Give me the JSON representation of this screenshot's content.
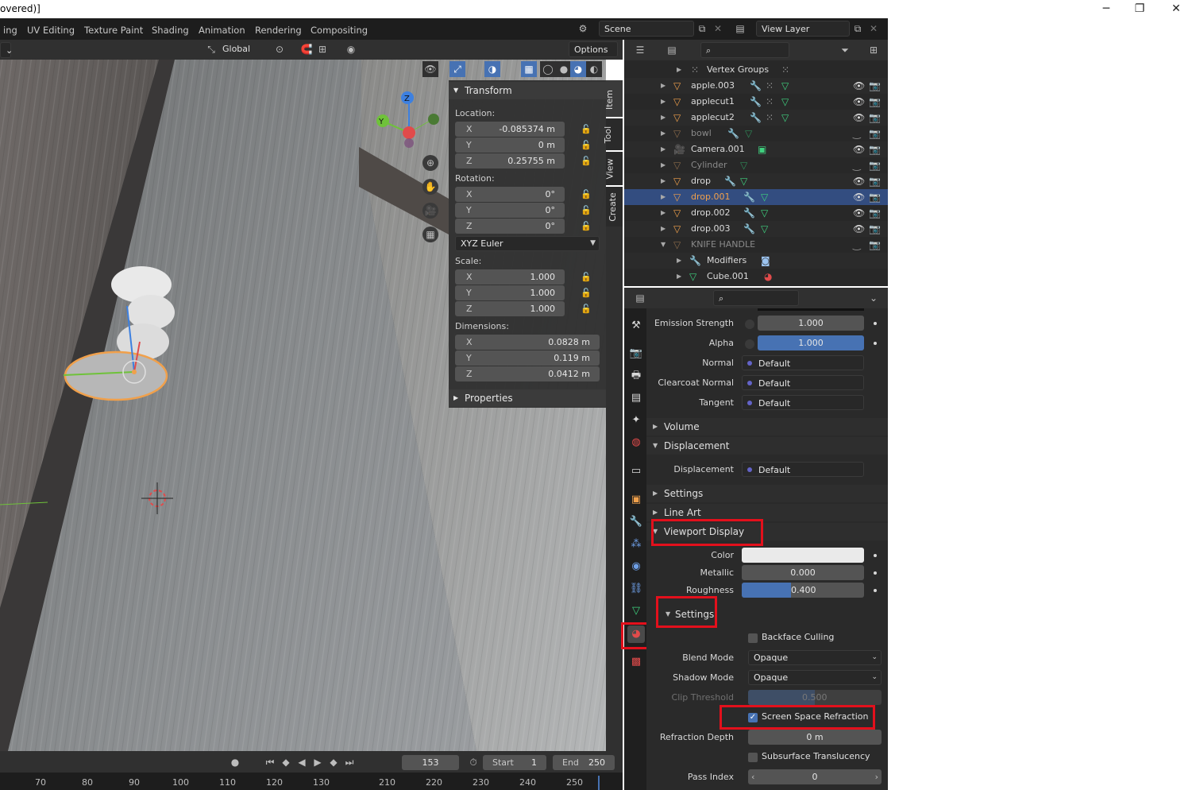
{
  "titlebar": {
    "title": "overed)]",
    "min": "─",
    "max": "❐",
    "close": "✕"
  },
  "workspaces": [
    "ing",
    "UV Editing",
    "Texture Paint",
    "Shading",
    "Animation",
    "Rendering",
    "Compositing"
  ],
  "scene": {
    "name": "Scene",
    "view_layer": "View Layer"
  },
  "viewport_header": {
    "orientation": "Global",
    "options": "Options"
  },
  "npanel": {
    "title": "Transform",
    "location_label": "Location:",
    "location": [
      [
        "X",
        "-0.085374 m"
      ],
      [
        "Y",
        "0 m"
      ],
      [
        "Z",
        "0.25755 m"
      ]
    ],
    "rotation_label": "Rotation:",
    "rotation": [
      [
        "X",
        "0°"
      ],
      [
        "Y",
        "0°"
      ],
      [
        "Z",
        "0°"
      ]
    ],
    "rotation_mode": "XYZ Euler",
    "scale_label": "Scale:",
    "scale": [
      [
        "X",
        "1.000"
      ],
      [
        "Y",
        "1.000"
      ],
      [
        "Z",
        "1.000"
      ]
    ],
    "dimensions_label": "Dimensions:",
    "dimensions": [
      [
        "X",
        "0.0828 m"
      ],
      [
        "Y",
        "0.119 m"
      ],
      [
        "Z",
        "0.0412 m"
      ]
    ],
    "properties": "Properties",
    "tabs": [
      "Item",
      "Tool",
      "View",
      "Create"
    ]
  },
  "outliner": {
    "rows": [
      {
        "name": "Vertex Groups"
      },
      {
        "name": "apple.003"
      },
      {
        "name": "applecut1"
      },
      {
        "name": "applecut2"
      },
      {
        "name": "bowl"
      },
      {
        "name": "Camera.001"
      },
      {
        "name": "Cylinder"
      },
      {
        "name": "drop"
      },
      {
        "name": "drop.001"
      },
      {
        "name": "drop.002"
      },
      {
        "name": "drop.003"
      },
      {
        "name": "KNIFE HANDLE"
      },
      {
        "name": "Modifiers"
      },
      {
        "name": "Cube.001"
      }
    ]
  },
  "properties": {
    "emission_strength_label": "Emission Strength",
    "emission_strength": "1.000",
    "alpha_label": "Alpha",
    "alpha": "1.000",
    "normal_label": "Normal",
    "normal": "Default",
    "clearcoat_normal_label": "Clearcoat Normal",
    "clearcoat_normal": "Default",
    "tangent_label": "Tangent",
    "tangent": "Default",
    "volume": "Volume",
    "displacement_section": "Displacement",
    "displacement_label": "Displacement",
    "displacement": "Default",
    "settings_section": "Settings",
    "line_art": "Line Art",
    "viewport_display": "Viewport Display",
    "color_label": "Color",
    "metallic_label": "Metallic",
    "metallic": "0.000",
    "roughness_label": "Roughness",
    "roughness": "0.400",
    "roughness_fraction": 0.4,
    "settings_sub": "Settings",
    "backface_culling": "Backface Culling",
    "blend_mode_label": "Blend Mode",
    "blend_mode": "Opaque",
    "shadow_mode_label": "Shadow Mode",
    "shadow_mode": "Opaque",
    "clip_threshold_label": "Clip Threshold",
    "clip_threshold": "0.500",
    "screen_space_refraction": "Screen Space Refraction",
    "refraction_depth_label": "Refraction Depth",
    "refraction_depth": "0 m",
    "subsurface_translucency": "Subsurface Translucency",
    "pass_index_label": "Pass Index",
    "pass_index": "0"
  },
  "timeline": {
    "current_frame": "153",
    "start_label": "Start",
    "start": "1",
    "end_label": "End",
    "end": "250"
  },
  "ruler_ticks": [
    "70",
    "80",
    "90",
    "100",
    "110",
    "120",
    "130",
    "210",
    "220",
    "230",
    "240",
    "250"
  ],
  "colors": {
    "accent": "#4772b3",
    "selected_row": "#334d80",
    "highlight": "#e3101c",
    "object_orange": "#f0a04b"
  }
}
